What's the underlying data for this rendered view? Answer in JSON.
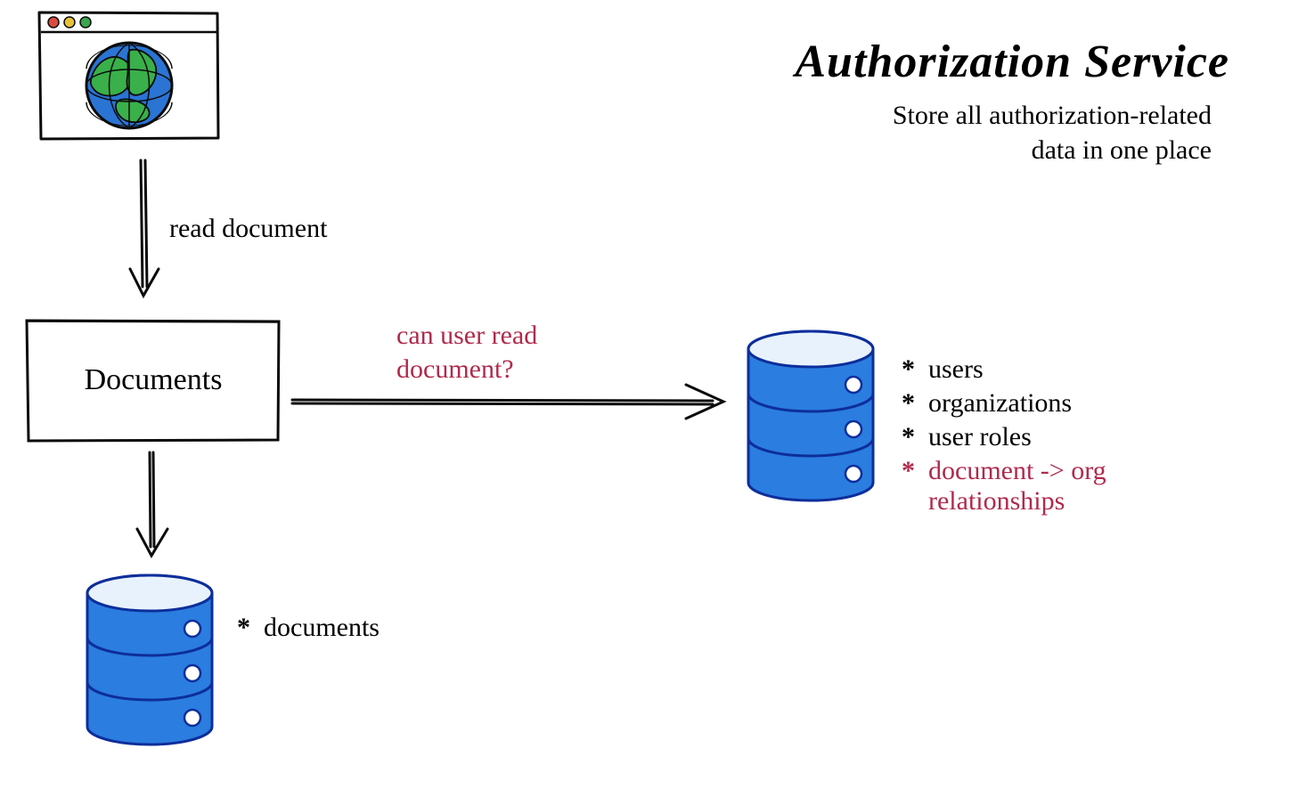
{
  "title": "Authorization Service",
  "subtitle_line1": "Store all authorization-related",
  "subtitle_line2": "data in one place",
  "browser_to_docs_label": "read document",
  "documents_box": "Documents",
  "docs_to_authz_line1": "can user read",
  "docs_to_authz_line2": "document?",
  "local_db_bullet": "documents",
  "authz_bullets": {
    "users": "users",
    "organizations": "organizations",
    "user_roles": "user roles",
    "doc_org_line1": "document -> org",
    "doc_org_line2": "relationships"
  },
  "colors": {
    "ink": "#0b0b0b",
    "maroon": "#b02a4c",
    "db_fill": "#2b7de0",
    "db_stroke": "#0d2e9a",
    "globe_land": "#39b04a",
    "globe_sea": "#2a74d4",
    "dot_red": "#d84b3e",
    "dot_yellow": "#e6c23a",
    "dot_green": "#3aa64f"
  }
}
